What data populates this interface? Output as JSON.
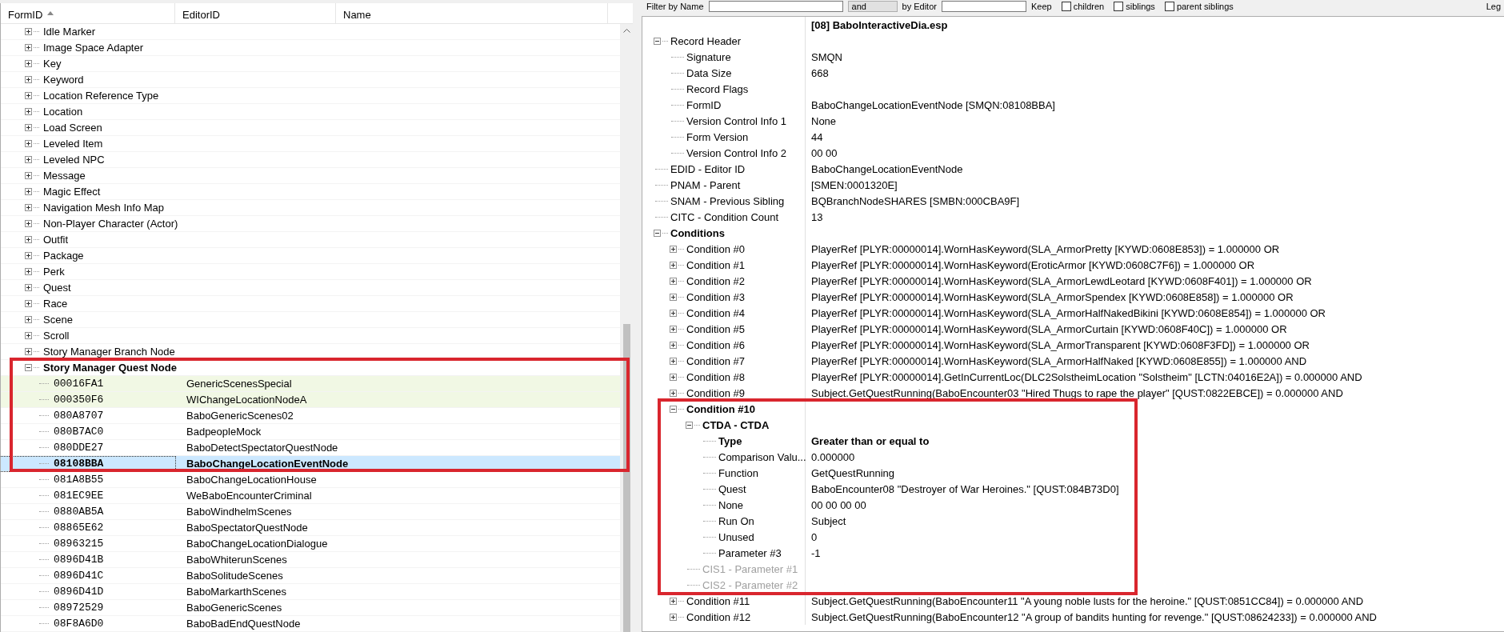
{
  "filter_bar": {
    "name_label": "Filter by Name",
    "join": "and",
    "editor_label": "by Editor",
    "keep_label": "Keep",
    "options": [
      {
        "label": "children",
        "checked": false
      },
      {
        "label": "siblings",
        "checked": false
      },
      {
        "label": "parent siblings",
        "checked": false
      }
    ],
    "legend": "Leg"
  },
  "object_tree": {
    "columns": [
      "FormID",
      "EditorID",
      "Name"
    ],
    "groups": [
      {
        "label": "Idle Marker",
        "expanded": false
      },
      {
        "label": "Image Space Adapter",
        "expanded": false
      },
      {
        "label": "Key",
        "expanded": false
      },
      {
        "label": "Keyword",
        "expanded": false
      },
      {
        "label": "Location Reference Type",
        "expanded": false
      },
      {
        "label": "Location",
        "expanded": false
      },
      {
        "label": "Load Screen",
        "expanded": false
      },
      {
        "label": "Leveled Item",
        "expanded": false
      },
      {
        "label": "Leveled NPC",
        "expanded": false
      },
      {
        "label": "Message",
        "expanded": false
      },
      {
        "label": "Magic Effect",
        "expanded": false
      },
      {
        "label": "Navigation Mesh Info Map",
        "expanded": false
      },
      {
        "label": "Non-Player Character (Actor)",
        "expanded": false
      },
      {
        "label": "Outfit",
        "expanded": false
      },
      {
        "label": "Package",
        "expanded": false
      },
      {
        "label": "Perk",
        "expanded": false
      },
      {
        "label": "Quest",
        "expanded": false
      },
      {
        "label": "Race",
        "expanded": false
      },
      {
        "label": "Scene",
        "expanded": false
      },
      {
        "label": "Scroll",
        "expanded": false
      },
      {
        "label": "Story Manager Branch Node",
        "expanded": false
      },
      {
        "label": "Story Manager Quest Node",
        "expanded": true,
        "children": [
          {
            "form_id": "00016FA1",
            "editor_id": "GenericScenesSpecial",
            "highlighted": true,
            "selected": false
          },
          {
            "form_id": "000350F6",
            "editor_id": "WIChangeLocationNodeA",
            "highlighted": true,
            "selected": false
          },
          {
            "form_id": "080A8707",
            "editor_id": "BaboGenericScenes02",
            "highlighted": false,
            "selected": false
          },
          {
            "form_id": "080B7AC0",
            "editor_id": "BadpeopleMock",
            "highlighted": false,
            "selected": false
          },
          {
            "form_id": "080DDE27",
            "editor_id": "BaboDetectSpectatorQuestNode",
            "highlighted": false,
            "selected": false
          },
          {
            "form_id": "08108BBA",
            "editor_id": "BaboChangeLocationEventNode",
            "highlighted": false,
            "selected": true
          },
          {
            "form_id": "081A8B55",
            "editor_id": "BaboChangeLocationHouse",
            "highlighted": false,
            "selected": false
          },
          {
            "form_id": "081EC9EE",
            "editor_id": "WeBaboEncounterCriminal",
            "highlighted": false,
            "selected": false
          },
          {
            "form_id": "0880AB5A",
            "editor_id": "BaboWindhelmScenes",
            "highlighted": false,
            "selected": false
          },
          {
            "form_id": "08865E62",
            "editor_id": "BaboSpectatorQuestNode",
            "highlighted": false,
            "selected": false
          },
          {
            "form_id": "08963215",
            "editor_id": "BaboChangeLocationDialogue",
            "highlighted": false,
            "selected": false
          },
          {
            "form_id": "0896D41B",
            "editor_id": "BaboWhiterunScenes",
            "highlighted": false,
            "selected": false
          },
          {
            "form_id": "0896D41C",
            "editor_id": "BaboSolitudeScenes",
            "highlighted": false,
            "selected": false
          },
          {
            "form_id": "0896D41D",
            "editor_id": "BaboMarkarthScenes",
            "highlighted": false,
            "selected": false
          },
          {
            "form_id": "08972529",
            "editor_id": "BaboGenericScenes",
            "highlighted": false,
            "selected": false
          },
          {
            "form_id": "08F8A6D0",
            "editor_id": "BaboBadEndQuestNode",
            "highlighted": false,
            "selected": false
          }
        ]
      }
    ]
  },
  "record_view": {
    "file_header": "[08] BaboInteractiveDia.esp",
    "rows": [
      {
        "label": "Record Header",
        "expanded": true,
        "children": [
          {
            "label": "Signature",
            "value": "SMQN"
          },
          {
            "label": "Data Size",
            "value": "668"
          },
          {
            "label": "Record Flags"
          },
          {
            "label": "FormID",
            "value": "BaboChangeLocationEventNode [SMQN:08108BBA]"
          },
          {
            "label": "Version Control Info 1",
            "value": "None"
          },
          {
            "label": "Form Version",
            "value": "44"
          },
          {
            "label": "Version Control Info 2",
            "value": "00 00"
          }
        ]
      },
      {
        "label": "EDID - Editor ID",
        "value": "BaboChangeLocationEventNode"
      },
      {
        "label": "PNAM - Parent",
        "value": "[SMEN:0001320E]"
      },
      {
        "label": "SNAM - Previous Sibling",
        "value": "BQBranchNodeSHARES [SMBN:000CBA9F]"
      },
      {
        "label": "CITC - Condition Count",
        "value": "13"
      },
      {
        "label": "Conditions",
        "bold": true,
        "expanded": true,
        "children": [
          {
            "label": "Condition #0",
            "expanded": false,
            "value": "PlayerRef [PLYR:00000014].WornHasKeyword(SLA_ArmorPretty [KYWD:0608E853]) = 1.000000 OR"
          },
          {
            "label": "Condition #1",
            "expanded": false,
            "value": "PlayerRef [PLYR:00000014].WornHasKeyword(EroticArmor [KYWD:0608C7F6]) = 1.000000 OR"
          },
          {
            "label": "Condition #2",
            "expanded": false,
            "value": "PlayerRef [PLYR:00000014].WornHasKeyword(SLA_ArmorLewdLeotard [KYWD:0608F401]) = 1.000000 OR"
          },
          {
            "label": "Condition #3",
            "expanded": false,
            "value": "PlayerRef [PLYR:00000014].WornHasKeyword(SLA_ArmorSpendex [KYWD:0608E858]) = 1.000000 OR"
          },
          {
            "label": "Condition #4",
            "expanded": false,
            "value": "PlayerRef [PLYR:00000014].WornHasKeyword(SLA_ArmorHalfNakedBikini [KYWD:0608E854]) = 1.000000 OR"
          },
          {
            "label": "Condition #5",
            "expanded": false,
            "value": "PlayerRef [PLYR:00000014].WornHasKeyword(SLA_ArmorCurtain [KYWD:0608F40C]) = 1.000000 OR"
          },
          {
            "label": "Condition #6",
            "expanded": false,
            "value": "PlayerRef [PLYR:00000014].WornHasKeyword(SLA_ArmorTransparent [KYWD:0608F3FD]) = 1.000000 OR"
          },
          {
            "label": "Condition #7",
            "expanded": false,
            "value": "PlayerRef [PLYR:00000014].WornHasKeyword(SLA_ArmorHalfNaked [KYWD:0608E855]) = 1.000000 AND"
          },
          {
            "label": "Condition #8",
            "expanded": false,
            "value": "PlayerRef [PLYR:00000014].GetInCurrentLoc(DLC2SolstheimLocation \"Solstheim\" [LCTN:04016E2A]) = 0.000000 AND"
          },
          {
            "label": "Condition #9",
            "expanded": false,
            "value": "Subject.GetQuestRunning(BaboEncounter03 \"Hired Thugs to rape the player\" [QUST:0822EBCE]) = 0.000000 AND"
          },
          {
            "label": "Condition #10",
            "bold": true,
            "expanded": true,
            "children": [
              {
                "label": "CTDA - CTDA",
                "bold": true,
                "expanded": true,
                "children": [
                  {
                    "label": "Type",
                    "bold": true,
                    "value": "Greater than or equal to"
                  },
                  {
                    "label": "Comparison Valu...",
                    "value": "0.000000"
                  },
                  {
                    "label": "Function",
                    "value": "GetQuestRunning"
                  },
                  {
                    "label": "Quest",
                    "value": "BaboEncounter08 \"Destroyer of War Heroines.\" [QUST:084B73D0]"
                  },
                  {
                    "label": "None",
                    "value": "00 00 00 00"
                  },
                  {
                    "label": "Run On",
                    "value": "Subject"
                  },
                  {
                    "label": "Unused",
                    "value": "0"
                  },
                  {
                    "label": "Parameter #3",
                    "value": "-1"
                  }
                ]
              },
              {
                "label": "CIS1 - Parameter #1",
                "disabled": true
              },
              {
                "label": "CIS2 - Parameter #2",
                "disabled": true
              }
            ]
          },
          {
            "label": "Condition #11",
            "expanded": false,
            "value": "Subject.GetQuestRunning(BaboEncounter11 \"A young noble lusts for the heroine.\" [QUST:0851CC84]) = 0.000000 AND"
          },
          {
            "label": "Condition #12",
            "expanded": false,
            "value": "Subject.GetQuestRunning(BaboEncounter12 \"A group of bandits hunting for revenge.\" [QUST:08624233]) = 0.000000 AND"
          }
        ]
      }
    ]
  }
}
